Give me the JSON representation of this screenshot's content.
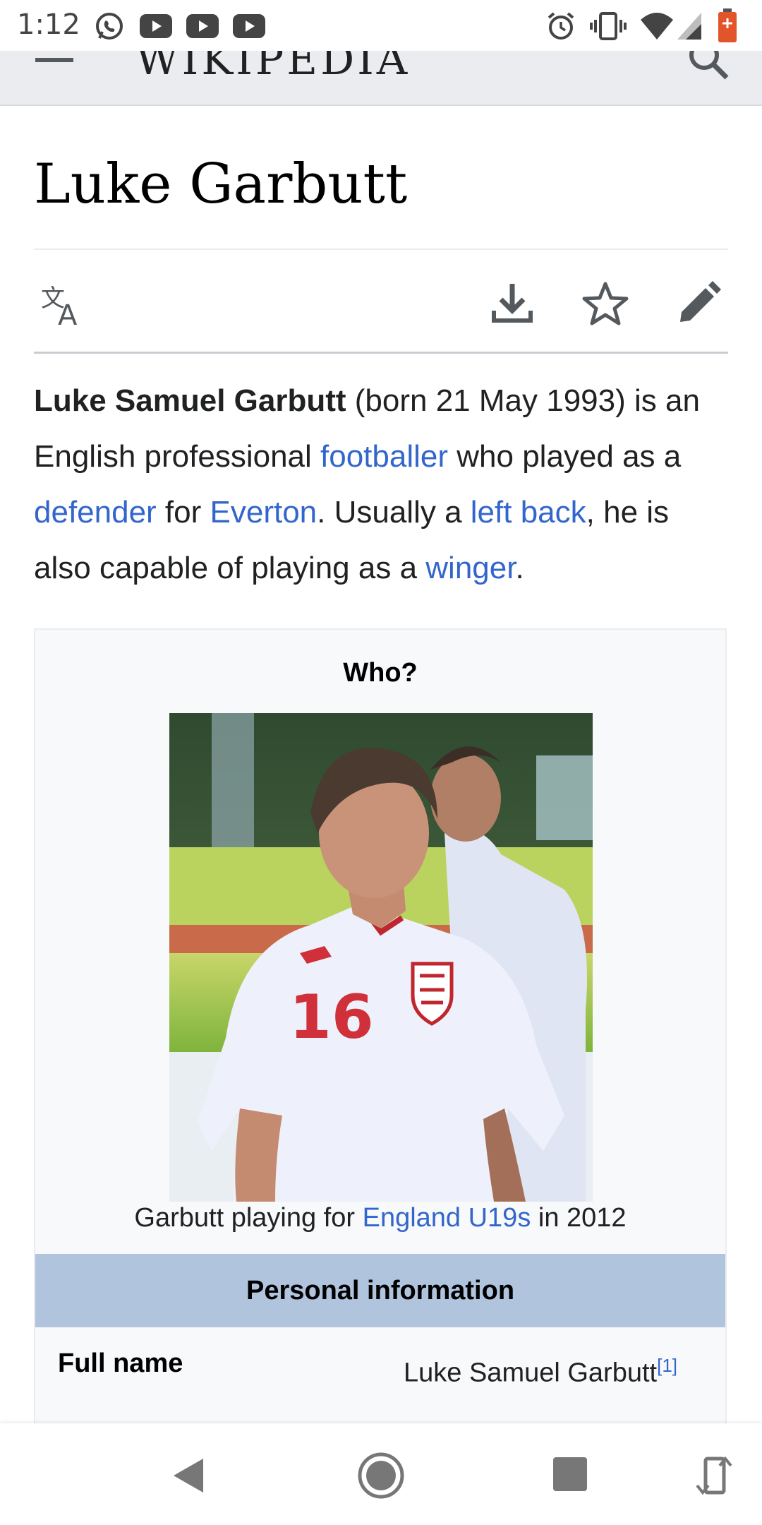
{
  "status_bar": {
    "time": "1:12",
    "icons": [
      "whatsapp-icon",
      "youtube-icon",
      "youtube-icon",
      "youtube-icon",
      "alarm-icon",
      "vibrate-icon",
      "wifi-icon",
      "signal-icon",
      "battery-icon"
    ]
  },
  "header": {
    "wordmark": "WIKIPEDIA",
    "menu_icon": "menu-icon",
    "search_icon": "search-icon"
  },
  "article": {
    "title": "Luke Garbutt",
    "toolbar": [
      "language-icon",
      "download-icon",
      "star-icon",
      "edit-icon"
    ],
    "lead": {
      "bold_name": "Luke Samuel Garbutt",
      "t1": " (born 21 May 1993) is an English professional ",
      "link1": "footballer",
      "t2": " who played as a ",
      "link2": "defender",
      "t3": " for ",
      "link3": "Everton",
      "t4": ". Usually a ",
      "link4": "left back",
      "t5": ", he is also capable of playing as a ",
      "link5": "winger",
      "t6": "."
    }
  },
  "infobox": {
    "above": "Who?",
    "caption_pre": "Garbutt playing for ",
    "caption_link": "England U19s",
    "caption_post": " in 2012",
    "section_header": "Personal information",
    "rows": [
      {
        "label": "Full name",
        "value": "Luke Samuel Garbutt",
        "ref": "[1]"
      }
    ]
  },
  "photo": {
    "shirt_number": "16"
  },
  "colors": {
    "link": "#3366cc",
    "header_bg": "#eaecf0",
    "section_header_bg": "#b0c4de",
    "infobox_bg": "#f8f9fa"
  },
  "nav_bar": {
    "icons": [
      "back-icon",
      "home-icon",
      "recents-icon",
      "rotate-icon"
    ]
  }
}
